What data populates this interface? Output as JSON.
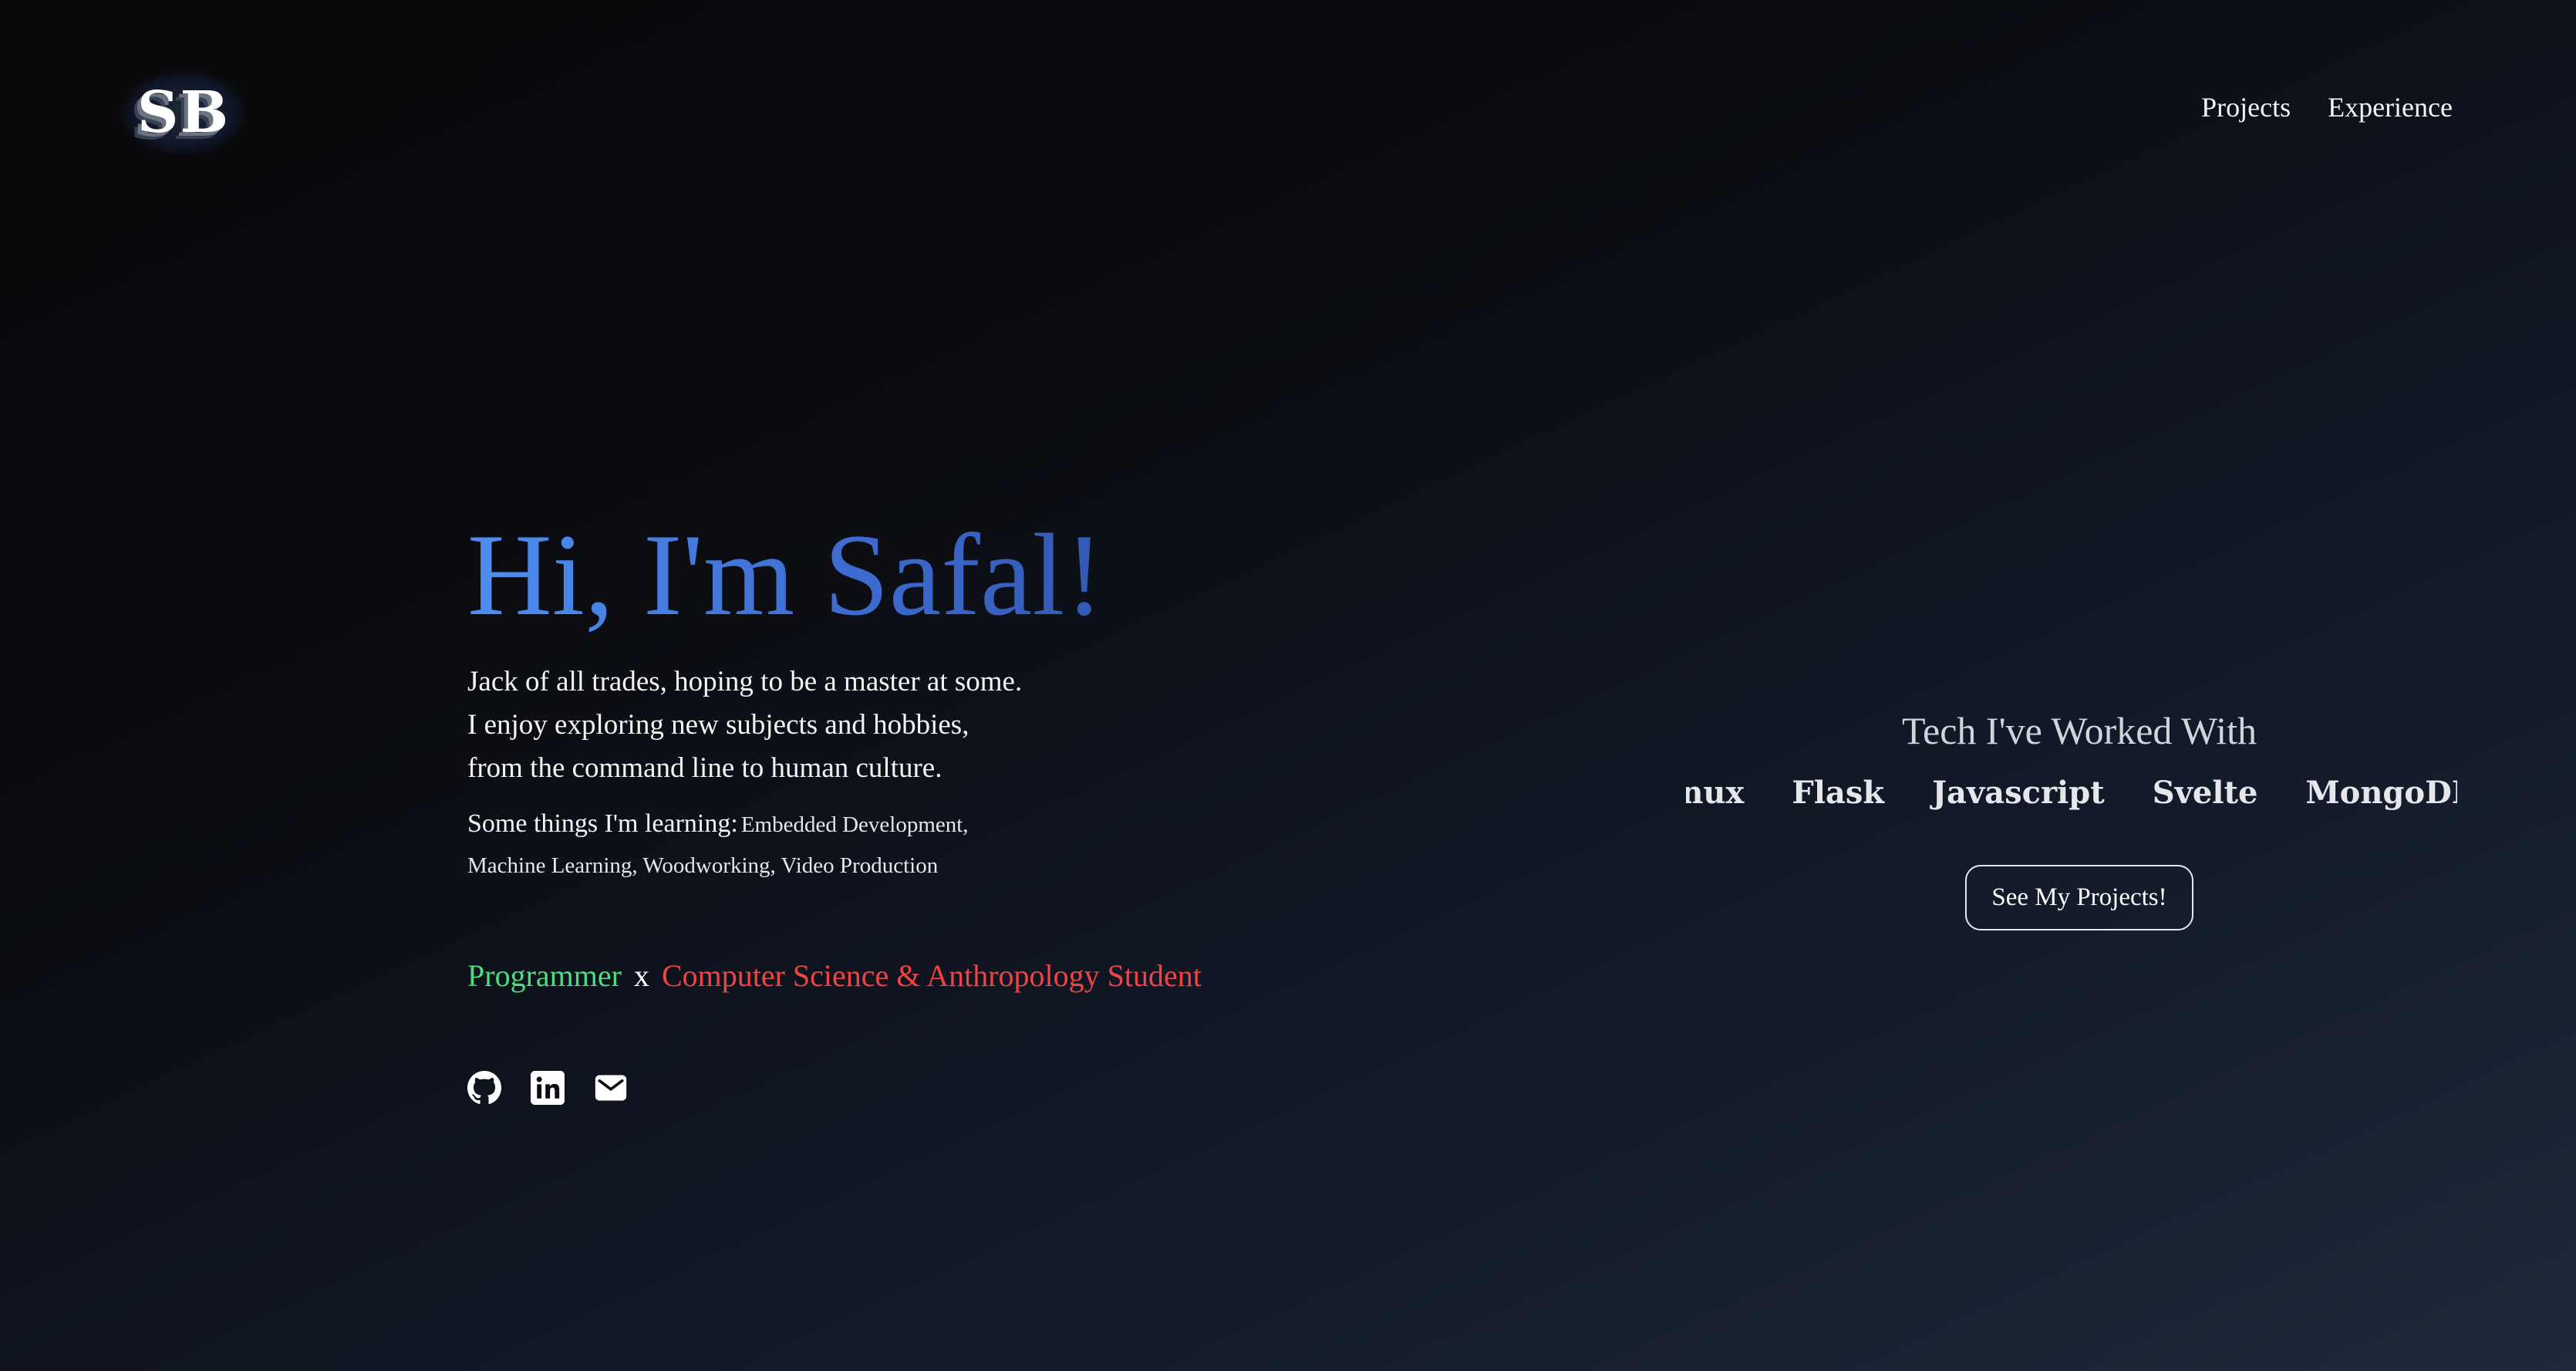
{
  "header": {
    "logo_text": "SB",
    "nav": [
      {
        "label": "Projects"
      },
      {
        "label": "Experience"
      }
    ]
  },
  "hero": {
    "title": "Hi, I'm Safal!",
    "description": "Jack of all trades, hoping to be a master at some. I enjoy exploring new subjects and hobbies, from the command line to human culture.",
    "learning_label": "Some things I'm learning:",
    "learning_items": "Embedded Development, Machine Learning, Woodworking, Video Production",
    "role_1": "Programmer",
    "role_separator": "x",
    "role_2": "Computer Science & Anthropology Student",
    "role_colors": {
      "role_1": "#4ade80",
      "role_2": "#ef4444"
    },
    "socials": [
      {
        "icon": "github-icon"
      },
      {
        "icon": "linkedin-icon"
      },
      {
        "icon": "mail-icon"
      }
    ]
  },
  "tech": {
    "title": "Tech I've Worked With",
    "items": [
      "Linux",
      "Flask",
      "Javascript",
      "Svelte",
      "MongoDB"
    ],
    "button_label": "See My Projects!"
  },
  "colors": {
    "title_gradient_start": "#4f8ef0",
    "title_gradient_end": "#2c4a9c",
    "background_dark": "#09090b",
    "background_light": "#1e293b"
  }
}
